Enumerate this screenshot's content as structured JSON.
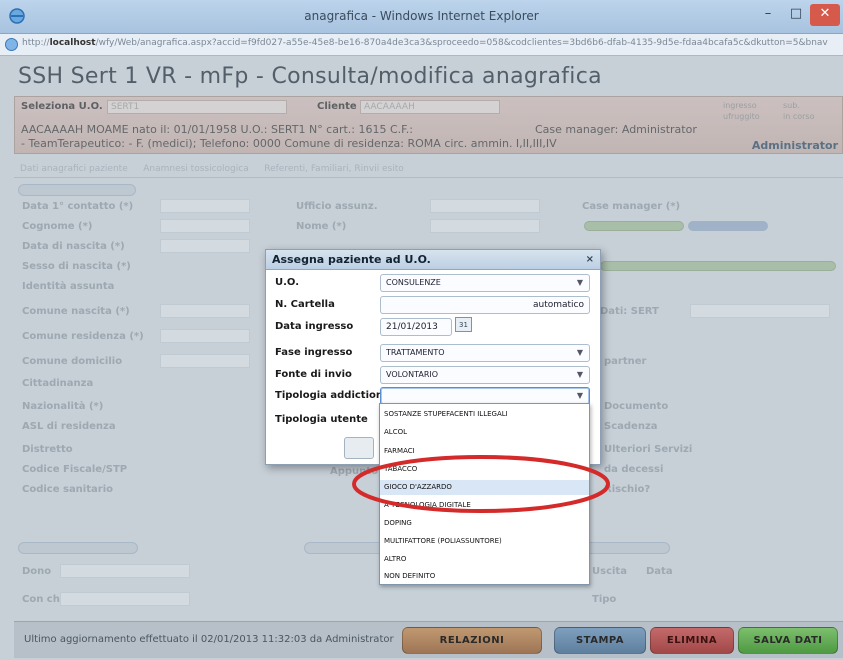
{
  "browser": {
    "title": "anagrafica - Windows Internet Explorer",
    "url_host": "localhost",
    "url_rest": "/wfy/Web/anagrafica.aspx?accid=f9fd027-a55e-45e8-be16-870a4de3ca3&sproceedo=058&codclientes=3bd6b6-dfab-4135-9d5e-fdaa4bcafa5c&dkutton=5&bnav"
  },
  "page": {
    "title": "SSH Sert 1 VR - mFp - Consulta/modifica anagrafica",
    "seleziona_label": "Seleziona U.O.",
    "seleziona_value": "SERT1",
    "cliente_label": "Cliente",
    "cliente_value": "AACAAAAH",
    "patient_line1": "AACAAAAH MOAME nato il: 01/01/1958 U.O.: SERT1 N° cart.: 1615 C.F.:",
    "patient_line2": "- TeamTerapeutico: - F. (medici); Telefono: 0000 Comune di residenza: ROMA circ. ammin. I,II,III,IV",
    "case_manager": "Case manager: Administrator",
    "user": "Administrator",
    "radio_opts": [
      "ingresso",
      "sub.",
      "ufruggito",
      "in corso"
    ],
    "tabs": [
      "Dati anagrafici paziente",
      "Anamnesi tossicologica",
      "Referenti, Familiari, Rinvii esito"
    ]
  },
  "background_form": {
    "labels_left": [
      "Data 1° contatto (*)",
      "Cognome (*)",
      "Data di nascita (*)",
      "Sesso di nascita (*)",
      "Identità assunta",
      "Comune nascita (*)",
      "Comune residenza (*)",
      "Comune domicilio",
      "Cittadinanza",
      "Nazionalità (*)",
      "ASL di residenza",
      "Distretto",
      "Codice Fiscale/STP",
      "Codice sanitario"
    ],
    "labels_mid": [
      "Ufficio assunz.",
      "Nome (*)"
    ],
    "labels_right": [
      "Case manager (*)",
      "Dati: SERT",
      "partner",
      "Documento",
      "Scadenza",
      "Ulteriori Servizi",
      "da decessi",
      "Rischio?"
    ],
    "bottom_left": [
      "Dono",
      "Con chi"
    ],
    "bottom_mid": "Appunto",
    "bottom_right": [
      "Uscita",
      "Data",
      "Tipo"
    ]
  },
  "footer": {
    "status": "Ultimo aggiornamento effettuato il 02/01/2013 11:32:03 da Administrator",
    "relazioni": "RELAZIONI",
    "stampa": "STAMPA",
    "elimina": "ELIMINA",
    "salva": "SALVA DATI"
  },
  "modal": {
    "title": "Assegna paziente ad U.O.",
    "close": "×",
    "fields": [
      {
        "label": "U.O.",
        "value": "CONSULENZE"
      },
      {
        "label": "N. Cartella",
        "value": "automatico"
      },
      {
        "label": "Data ingresso",
        "value": "21/01/2013"
      },
      {
        "label": "Fase ingresso",
        "value": "TRATTAMENTO"
      },
      {
        "label": "Fonte di invio",
        "value": "VOLONTARIO"
      },
      {
        "label": "Tipologia addiction",
        "value": ""
      },
      {
        "label": "Tipologia utente",
        "value": ""
      }
    ],
    "calendar_icon": "31"
  },
  "dropdown": {
    "options": [
      "SOSTANZE STUPEFACENTI ILLEGALI",
      "ALCOL",
      "FARMACI",
      "TABACCO",
      "GIOCO D'AZZARDO",
      "A TECNOLOGIA DIGITALE",
      "DOPING",
      "MULTIFATTORE (POLIASSUNTORE)",
      "ALTRO",
      "NON DEFINITO"
    ],
    "highlighted": "GIOCO D'AZZARDO"
  },
  "colors": {
    "annotation_ellipse": "#d42a2a",
    "infobar": "#c9b2ab",
    "salva": "#5aaa4c",
    "elimina": "#b35454",
    "stampa": "#6c8cac",
    "relazioni": "#ae8562"
  },
  "icons": [
    "ie-logo-icon",
    "minimize-icon",
    "maximize-icon",
    "close-icon",
    "calendar-icon",
    "chevron-down-icon",
    "user-icon"
  ]
}
